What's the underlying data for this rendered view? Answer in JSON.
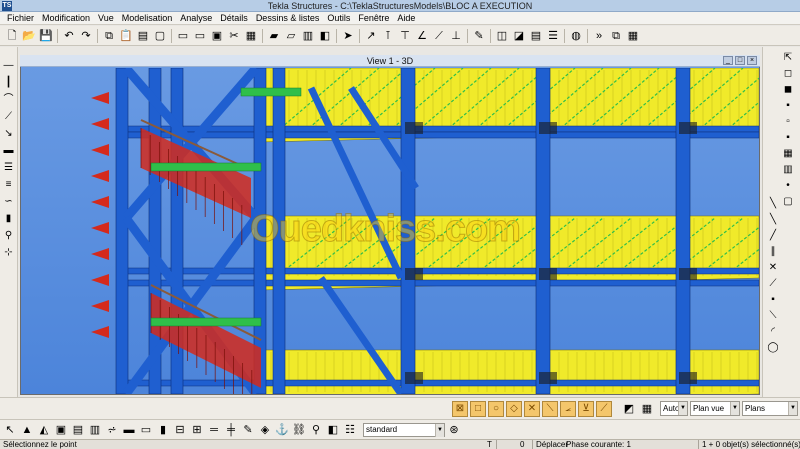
{
  "window": {
    "app_icon_label": "TS",
    "title": "Tekla Structures - C:\\TeklaStructuresModels\\BLOC A EXECUTION"
  },
  "menu": [
    "Fichier",
    "Modification",
    "Vue",
    "Modelisation",
    "Analyse",
    "Détails",
    "Dessins & listes",
    "Outils",
    "Fenêtre",
    "Aide"
  ],
  "toolbar_top": [
    {
      "name": "new-icon",
      "glyph": "🗋"
    },
    {
      "name": "open-icon",
      "glyph": "📂"
    },
    {
      "name": "save-icon",
      "glyph": "💾"
    },
    {
      "sep": true
    },
    {
      "name": "undo-icon",
      "glyph": "↶"
    },
    {
      "name": "redo-icon",
      "glyph": "↷"
    },
    {
      "sep": true
    },
    {
      "name": "copy-icon",
      "glyph": "⧉"
    },
    {
      "name": "paste-icon",
      "glyph": "📋"
    },
    {
      "name": "clipboard-icon",
      "glyph": "▤"
    },
    {
      "name": "window-icon",
      "glyph": "▢"
    },
    {
      "sep": true
    },
    {
      "name": "view-rect-icon",
      "glyph": "▭"
    },
    {
      "name": "view-rect2-icon",
      "glyph": "▭"
    },
    {
      "name": "view-frame-icon",
      "glyph": "▣"
    },
    {
      "name": "cut-icon",
      "glyph": "✂"
    },
    {
      "name": "grid-icon",
      "glyph": "▦"
    },
    {
      "sep": true
    },
    {
      "name": "folder-icon",
      "glyph": "▰"
    },
    {
      "name": "folder-open-icon",
      "glyph": "▱"
    },
    {
      "name": "image-icon",
      "glyph": "▥"
    },
    {
      "name": "part-icon",
      "glyph": "◧"
    },
    {
      "sep": true
    },
    {
      "name": "pointer-icon",
      "glyph": "➤"
    },
    {
      "sep": true
    },
    {
      "name": "help-arrow-icon",
      "glyph": "↗"
    },
    {
      "name": "measure-icon",
      "glyph": "⊺"
    },
    {
      "name": "measure2-icon",
      "glyph": "⊤"
    },
    {
      "name": "angle-icon",
      "glyph": "∠"
    },
    {
      "name": "ruler-icon",
      "glyph": "⟋"
    },
    {
      "name": "dim-icon",
      "glyph": "⊥"
    },
    {
      "sep": true
    },
    {
      "name": "pen-icon",
      "glyph": "✎"
    },
    {
      "sep": true
    },
    {
      "name": "layers-icon",
      "glyph": "◫"
    },
    {
      "name": "components-icon",
      "glyph": "◪"
    },
    {
      "name": "report-icon",
      "glyph": "▤"
    },
    {
      "name": "list-icon",
      "glyph": "☰"
    },
    {
      "sep": true
    },
    {
      "name": "globe-icon",
      "glyph": "◍"
    },
    {
      "sep": true
    },
    {
      "name": "forward-icon",
      "glyph": "»"
    },
    {
      "name": "link-icon",
      "glyph": "⧉"
    },
    {
      "name": "sheet-icon",
      "glyph": "▦"
    }
  ],
  "leftbar": [
    {
      "name": "beam-icon",
      "glyph": "—"
    },
    {
      "name": "column-icon",
      "glyph": "┃"
    },
    {
      "name": "curved-beam-icon",
      "glyph": "⌒"
    },
    {
      "name": "polybeam-icon",
      "glyph": "⟋"
    },
    {
      "name": "brace-icon",
      "glyph": "↘"
    },
    {
      "name": "panel-icon",
      "glyph": "▬"
    },
    {
      "name": "slab-icon",
      "glyph": "☰"
    },
    {
      "name": "pad-icon",
      "glyph": "≡"
    },
    {
      "name": "strip-icon",
      "glyph": "∽"
    },
    {
      "name": "bolt-icon",
      "glyph": "▮"
    },
    {
      "name": "weld-icon",
      "glyph": "⚲"
    },
    {
      "name": "fitting-icon",
      "glyph": "⊹"
    }
  ],
  "rightbar_top": [
    {
      "name": "cursor-icon",
      "glyph": "⇱"
    },
    {
      "name": "select-all-icon",
      "glyph": "◻"
    },
    {
      "name": "select-part-icon",
      "glyph": "◼"
    },
    {
      "name": "select-assembly-icon",
      "glyph": "▪"
    },
    {
      "name": "select-weld-icon",
      "glyph": "▫"
    },
    {
      "name": "select-bolt-icon",
      "glyph": "▪"
    },
    {
      "name": "select-grid-icon",
      "glyph": "▦"
    },
    {
      "name": "select-plane-icon",
      "glyph": "▥"
    },
    {
      "name": "select-point-icon",
      "glyph": "•"
    },
    {
      "name": "select-view-icon",
      "glyph": "▢"
    }
  ],
  "rightbar_bottom": [
    {
      "name": "line-red-icon",
      "glyph": "╲"
    },
    {
      "name": "line-blue-icon",
      "glyph": "╲"
    },
    {
      "name": "line-green-icon",
      "glyph": "╱"
    },
    {
      "name": "parallel-icon",
      "glyph": "∥"
    },
    {
      "name": "cross-icon",
      "glyph": "✕"
    },
    {
      "name": "angle-line-icon",
      "glyph": "⟋"
    },
    {
      "name": "point-icon",
      "glyph": "▪"
    },
    {
      "name": "offset-icon",
      "glyph": "⟍"
    },
    {
      "name": "arc-icon",
      "glyph": "◜"
    },
    {
      "name": "circle-icon",
      "glyph": "◯"
    }
  ],
  "view": {
    "title": "View 1 - 3D",
    "controls": [
      "_",
      "□",
      "×"
    ]
  },
  "watermark": "Ouedkniss.com",
  "snap_buttons": [
    {
      "name": "snap-x-icon",
      "glyph": "⊠"
    },
    {
      "name": "snap-square-icon",
      "glyph": "□"
    },
    {
      "name": "snap-circle-icon",
      "glyph": "○"
    },
    {
      "name": "snap-diamond-icon",
      "glyph": "◇"
    },
    {
      "name": "snap-cross-icon",
      "glyph": "✕"
    },
    {
      "name": "snap-edge-icon",
      "glyph": "⟍"
    },
    {
      "name": "snap-angle-icon",
      "glyph": "⦟"
    },
    {
      "name": "snap-perp-icon",
      "glyph": "⊻"
    },
    {
      "name": "snap-slant-icon",
      "glyph": "⟋"
    }
  ],
  "snap_extras": [
    {
      "name": "snap-3d-icon",
      "glyph": "◩"
    },
    {
      "name": "snap-grid-icon",
      "glyph": "▦"
    }
  ],
  "dropdowns": {
    "snap_depth": "Auto",
    "plane": "Plan vue",
    "edges": "Plans contours"
  },
  "toolbar_bottom": [
    {
      "name": "select-icon",
      "glyph": "↖"
    },
    {
      "name": "select-tri-icon",
      "glyph": "▲"
    },
    {
      "name": "select-yz-icon",
      "glyph": "◭"
    },
    {
      "name": "select-box-icon",
      "glyph": "▣"
    },
    {
      "name": "select-table-icon",
      "glyph": "▤"
    },
    {
      "name": "select-panel-icon",
      "glyph": "▥"
    },
    {
      "name": "select-stair-icon",
      "glyph": "⩫"
    },
    {
      "name": "select-row-icon",
      "glyph": "▬"
    },
    {
      "name": "select-plate-icon",
      "glyph": "▭"
    },
    {
      "name": "select-col-icon",
      "glyph": "▮"
    },
    {
      "name": "select-cut-icon",
      "glyph": "⊟"
    },
    {
      "name": "select-grid2-icon",
      "glyph": "⊞"
    },
    {
      "name": "select-beam2-icon",
      "glyph": "═"
    },
    {
      "name": "select-beam3-icon",
      "glyph": "╪"
    },
    {
      "name": "select-pen-icon",
      "glyph": "✎"
    },
    {
      "name": "select-node-icon",
      "glyph": "◈"
    },
    {
      "name": "select-anchor-icon",
      "glyph": "⚓"
    },
    {
      "name": "select-chain-icon",
      "glyph": "⛓"
    },
    {
      "name": "select-weld2-icon",
      "glyph": "⚲"
    },
    {
      "name": "select-cube-icon",
      "glyph": "◧"
    },
    {
      "name": "select-list-icon",
      "glyph": "☷"
    }
  ],
  "filter_select": "standard",
  "status": {
    "message": "Sélectionnez le point",
    "mode": "T",
    "count": "0",
    "action": "Déplacer",
    "phase": "Phase courante: 1",
    "selection": "1 + 0 objet(s) sélectionné(s)"
  },
  "colors": {
    "steel_blue": "#1f5fd0",
    "slab_yellow": "#f0ea2a",
    "stair_red": "#d42a1c",
    "handrail_brown": "#8a5a3a",
    "node_green": "#2fbf4a",
    "background_top": "#6a9be3"
  }
}
